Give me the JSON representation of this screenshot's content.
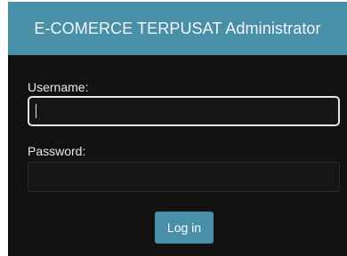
{
  "header": {
    "title": "E-COMERCE TERPUSAT Administrator"
  },
  "form": {
    "username_label": "Username:",
    "username_value": "",
    "password_label": "Password:",
    "password_value": "",
    "submit_label": "Log in"
  },
  "colors": {
    "header_bg": "#4a8fa8",
    "card_bg": "#121212",
    "button_bg": "#4a8fa8"
  }
}
